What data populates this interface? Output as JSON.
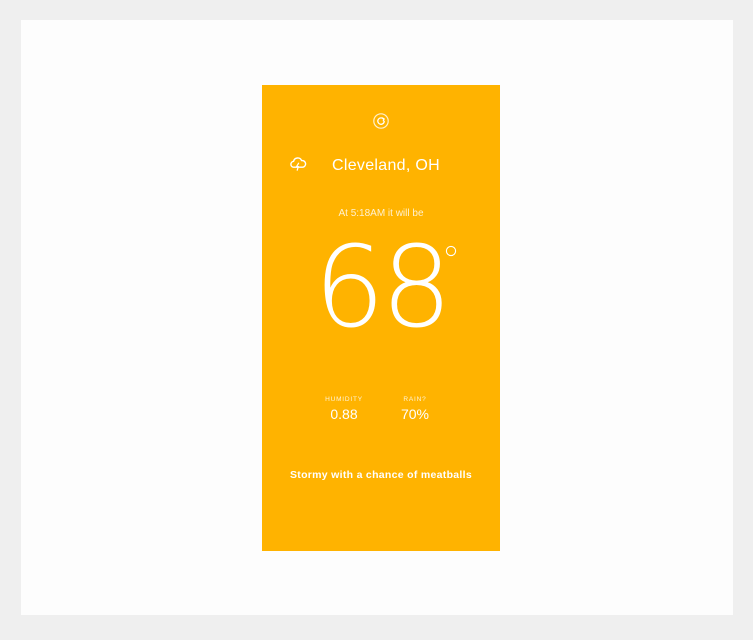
{
  "weather": {
    "location": "Cleveland, OH",
    "time_line": "At 5:18AM it will be",
    "temperature": "68",
    "humidity_label": "HUMIDITY",
    "humidity_value": "0.88",
    "rain_label": "RAIN?",
    "rain_value": "70%",
    "summary": "Stormy with a chance of meatballs"
  },
  "icons": {
    "refresh": "refresh-icon",
    "condition": "cloud-icon",
    "degree": "degree-symbol"
  },
  "colors": {
    "card_background": "#ffb300",
    "text": "#ffffff",
    "page_background": "#fdfdfd",
    "outer_border": "#efefef"
  }
}
